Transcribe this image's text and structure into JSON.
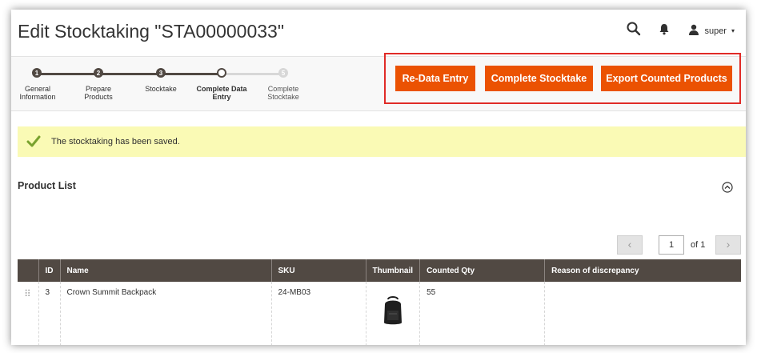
{
  "header": {
    "title": "Edit Stocktaking \"STA00000033\"",
    "search_icon": "search-icon",
    "notification_icon": "bell-icon",
    "user_name": "super",
    "user_caret": "▾"
  },
  "progress": {
    "steps": [
      {
        "number": "1",
        "label_line1": "General",
        "label_line2": "Information",
        "status": "done"
      },
      {
        "number": "2",
        "label_line1": "Prepare",
        "label_line2": "Products",
        "status": "done"
      },
      {
        "number": "3",
        "label_line1": "Stocktake",
        "label_line2": "",
        "status": "done"
      },
      {
        "number": "4",
        "label_line1": "Complete Data",
        "label_line2": "Entry",
        "status": "current"
      },
      {
        "number": "5",
        "label_line1": "Complete",
        "label_line2": "Stocktake",
        "status": "todo"
      }
    ]
  },
  "actions": {
    "redata_label": "Re-Data Entry",
    "complete_label": "Complete Stocktake",
    "export_label": "Export Counted Products"
  },
  "message": {
    "text": "The stocktaking has been saved."
  },
  "product_list": {
    "title": "Product List",
    "pager": {
      "prev": "‹",
      "next": "›",
      "current_page": "1",
      "of_text": "of 1"
    },
    "columns": [
      "ID",
      "Name",
      "SKU",
      "Thumbnail",
      "Counted Qty",
      "Reason of discrepancy"
    ],
    "rows": [
      {
        "drag": "⠿",
        "id": "3",
        "name": "Crown Summit Backpack",
        "sku": "24-MB03",
        "thumbnail": "backpack-image",
        "counted_qty": "55",
        "reason": ""
      }
    ]
  },
  "colors": {
    "accent": "#eb5202",
    "highlight_border": "#e02b27",
    "grid_header": "#514943",
    "message_bg": "#fafab5",
    "success": "#79a22e"
  }
}
